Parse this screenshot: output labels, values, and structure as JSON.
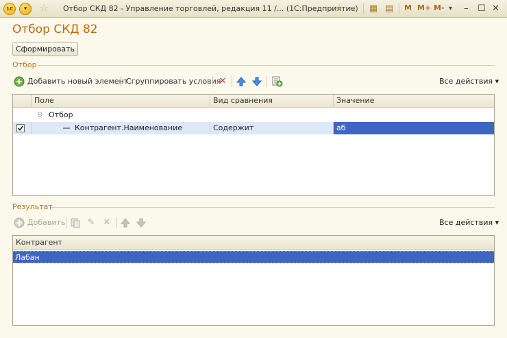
{
  "window": {
    "logo_text": "1С",
    "title": "Отбор СКД 82 - Управление торговлей, редакция 11 /...  (1С:Предприятие)",
    "m_labels": [
      "M",
      "M+",
      "M-"
    ]
  },
  "form": {
    "title": "Отбор СКД 82",
    "generate_button": "Сформировать"
  },
  "filter": {
    "group_label": "Отбор",
    "add_element": "Добавить новый элемент",
    "group_conditions": "Сгруппировать условия",
    "all_actions": "Все действия",
    "columns": [
      "Поле",
      "Вид сравнения",
      "Значение"
    ],
    "rows": [
      {
        "field": "Отбор",
        "comparison": "",
        "value": ""
      },
      {
        "field": "Контрагент.Наименование",
        "comparison": "Содержит",
        "value": "аб",
        "checked": true
      }
    ]
  },
  "result": {
    "group_label": "Результат",
    "add": "Добавить",
    "all_actions": "Все действия",
    "columns": [
      "Контрагент"
    ],
    "rows": [
      "Лабан"
    ]
  },
  "colors": {
    "accent_title": "#c2670e",
    "selection": "#3e66c0",
    "row_highlight": "#dde8f8"
  }
}
